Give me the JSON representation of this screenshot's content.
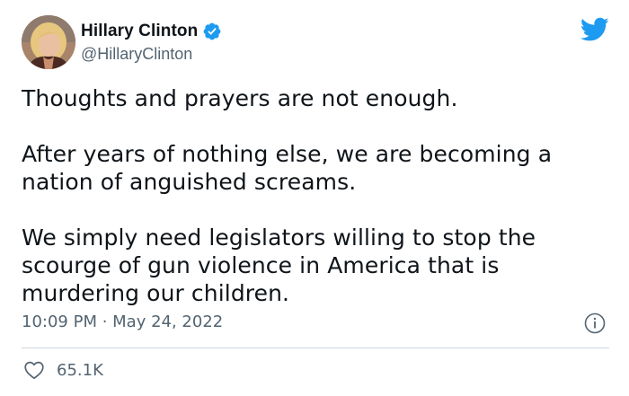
{
  "author": {
    "display_name": "Hillary Clinton",
    "handle": "@HillaryClinton",
    "verified": true,
    "avatar": "profile-photo"
  },
  "icons": {
    "brand": "twitter-bird-icon",
    "verified": "verified-badge-icon",
    "info": "info-icon",
    "like": "heart-icon"
  },
  "colors": {
    "twitter_blue": "#1d9bf0",
    "text_primary": "#0f1419",
    "text_secondary": "#536471",
    "divider": "#cfd9de"
  },
  "tweet": {
    "paragraphs": [
      "Thoughts and prayers are not enough.",
      "After years of nothing else, we are becoming a nation of anguished screams.",
      "We simply need legislators willing to stop the scourge of gun violence in America that is murdering our children."
    ],
    "timestamp": "10:09 PM · May 24, 2022",
    "likes": "65.1K"
  }
}
